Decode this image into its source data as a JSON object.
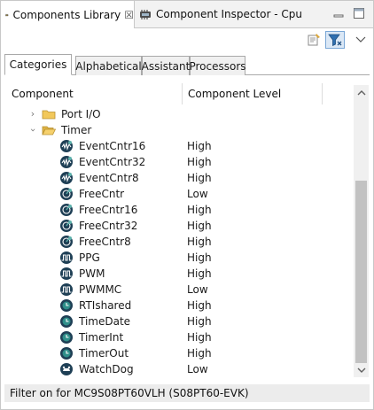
{
  "view_tabs": [
    {
      "label": "Components Library",
      "close": "☒",
      "active": true
    },
    {
      "label": "Component Inspector - Cpu",
      "active": false
    }
  ],
  "toolbar": {
    "properties_icon": "properties-icon",
    "filter_icon": "filter-icon",
    "view_menu_icon": "view-menu-icon"
  },
  "sub_tabs": [
    "Categories",
    "Alphabetical",
    "Assistant",
    "Processors"
  ],
  "table": {
    "columns": [
      "Component",
      "Component Level"
    ],
    "tree": [
      {
        "label": "Port I/O",
        "type": "folder",
        "expanded": false
      },
      {
        "label": "Timer",
        "type": "folder",
        "expanded": true
      }
    ],
    "components": [
      {
        "name": "EventCntr16",
        "level": "High",
        "icon": "event-counter-icon"
      },
      {
        "name": "EventCntr32",
        "level": "High",
        "icon": "event-counter-icon"
      },
      {
        "name": "EventCntr8",
        "level": "High",
        "icon": "event-counter-icon"
      },
      {
        "name": "FreeCntr",
        "level": "Low",
        "icon": "free-counter-icon"
      },
      {
        "name": "FreeCntr16",
        "level": "High",
        "icon": "free-counter-icon"
      },
      {
        "name": "FreeCntr32",
        "level": "High",
        "icon": "free-counter-icon"
      },
      {
        "name": "FreeCntr8",
        "level": "High",
        "icon": "free-counter-icon"
      },
      {
        "name": "PPG",
        "level": "High",
        "icon": "pulse-icon"
      },
      {
        "name": "PWM",
        "level": "High",
        "icon": "pulse-icon"
      },
      {
        "name": "PWMMC",
        "level": "Low",
        "icon": "pulse-icon"
      },
      {
        "name": "RTIshared",
        "level": "High",
        "icon": "clock-icon"
      },
      {
        "name": "TimeDate",
        "level": "High",
        "icon": "clock-icon"
      },
      {
        "name": "TimerInt",
        "level": "High",
        "icon": "clock-icon"
      },
      {
        "name": "TimerOut",
        "level": "High",
        "icon": "clock-icon"
      },
      {
        "name": "WatchDog",
        "level": "Low",
        "icon": "watchdog-icon"
      }
    ]
  },
  "status": "Filter on for MC9S08PT60VLH (S08PT60-EVK)",
  "colors": {
    "icon_dark": "#1e3f55",
    "icon_teal": "#2f8f8a",
    "folder": "#e9b949",
    "selection": "#dbe8f6"
  }
}
